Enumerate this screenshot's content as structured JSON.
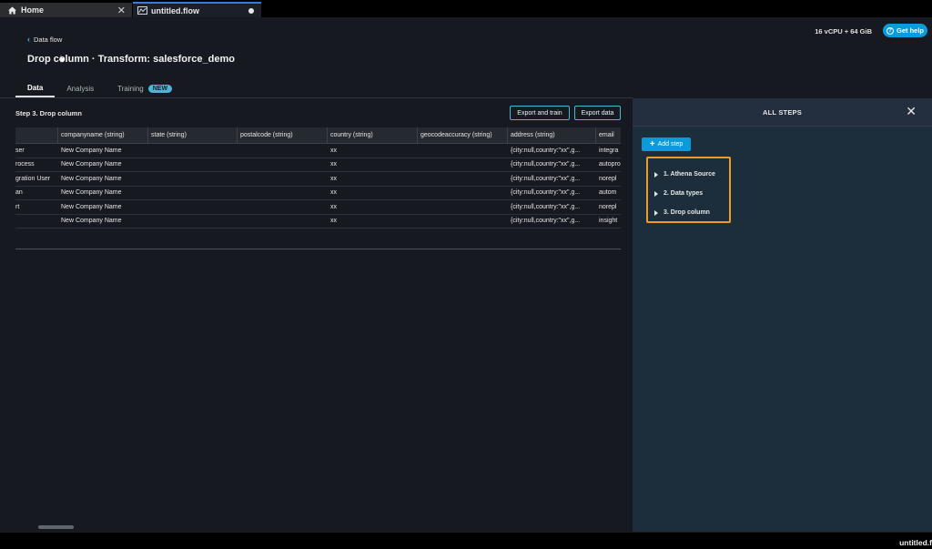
{
  "tabs": {
    "home_label": "Home",
    "flow_label": "untitled.flow"
  },
  "header": {
    "resources": "16 vCPU + 64 GiB",
    "help_label": "Get help",
    "back_label": "Data flow",
    "title": "Drop column · Transform: salesforce_demo"
  },
  "view_tabs": [
    {
      "label": "Data"
    },
    {
      "label": "Analysis"
    },
    {
      "label": "Training",
      "badge": "NEW"
    }
  ],
  "step": {
    "title": "Step 3. Drop column",
    "export_train_label": "Export and train",
    "export_data_label": "Export data"
  },
  "table": {
    "columns": [
      "",
      "companyname (string)",
      "state (string)",
      "postalcode (string)",
      "country (string)",
      "geocodeaccuracy (string)",
      "address (string)",
      "email"
    ],
    "rows": [
      [
        "ser",
        "New Company Name",
        "",
        "",
        "xx",
        "",
        "{city:null,country:\"xx\",g...",
        "integra"
      ],
      [
        "rocess",
        "New Company Name",
        "",
        "",
        "xx",
        "",
        "{city:null,country:\"xx\",g...",
        "autopro"
      ],
      [
        "gration User",
        "New Company Name",
        "",
        "",
        "xx",
        "",
        "{city:null,country:\"xx\",g...",
        "norepl"
      ],
      [
        "an",
        "New Company Name",
        "",
        "",
        "xx",
        "",
        "{city:null,country:\"xx\",g...",
        "autom"
      ],
      [
        "rt",
        "New Company Name",
        "",
        "",
        "xx",
        "",
        "{city:null,country:\"xx\",g...",
        "norepl"
      ],
      [
        "",
        "New Company Name",
        "",
        "",
        "xx",
        "",
        "{city:null,country:\"xx\",g...",
        "insight"
      ]
    ]
  },
  "panel": {
    "title": "ALL STEPS",
    "add_step_label": "Add step",
    "steps": [
      "1. Athena Source",
      "2. Data types",
      "3. Drop column"
    ]
  },
  "status_bar": {
    "text": "untitled.f"
  },
  "colors": {
    "accent": "#0a9bd9",
    "highlight": "#f09a24",
    "panel_bg": "#1c2e3b"
  }
}
